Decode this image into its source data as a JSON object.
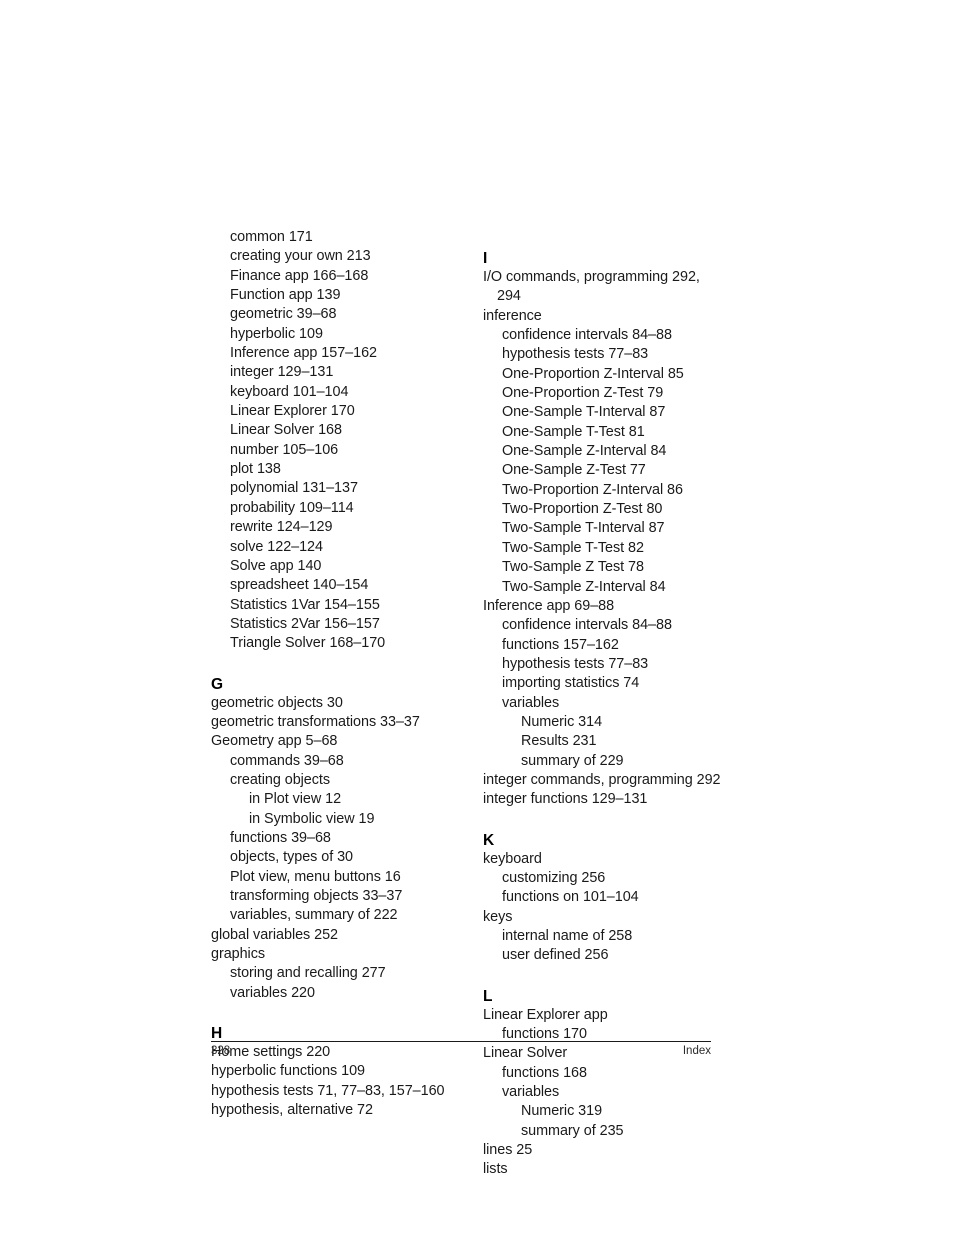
{
  "document": {
    "type": "book-index-page",
    "footer": {
      "page_number": "328",
      "section_label": "Index"
    }
  },
  "columns": {
    "left": {
      "continued_entries": [
        {
          "text": "common 171",
          "level": 1
        },
        {
          "text": "creating your own 213",
          "level": 1
        },
        {
          "text": "Finance app 166–168",
          "level": 1
        },
        {
          "text": "Function app 139",
          "level": 1
        },
        {
          "text": "geometric 39–68",
          "level": 1
        },
        {
          "text": "hyperbolic 109",
          "level": 1
        },
        {
          "text": "Inference app 157–162",
          "level": 1
        },
        {
          "text": "integer 129–131",
          "level": 1
        },
        {
          "text": "keyboard 101–104",
          "level": 1
        },
        {
          "text": "Linear Explorer 170",
          "level": 1
        },
        {
          "text": "Linear Solver 168",
          "level": 1
        },
        {
          "text": "number 105–106",
          "level": 1
        },
        {
          "text": "plot 138",
          "level": 1
        },
        {
          "text": "polynomial 131–137",
          "level": 1
        },
        {
          "text": "probability 109–114",
          "level": 1
        },
        {
          "text": "rewrite 124–129",
          "level": 1
        },
        {
          "text": "solve 122–124",
          "level": 1
        },
        {
          "text": "Solve app 140",
          "level": 1
        },
        {
          "text": "spreadsheet 140–154",
          "level": 1
        },
        {
          "text": "Statistics 1Var 154–155",
          "level": 1
        },
        {
          "text": "Statistics 2Var 156–157",
          "level": 1
        },
        {
          "text": "Triangle Solver 168–170",
          "level": 1
        }
      ],
      "sections": [
        {
          "letter": "G",
          "entries": [
            {
              "text": "geometric objects 30",
              "level": 0
            },
            {
              "text": "geometric transformations 33–37",
              "level": 0
            },
            {
              "text": "Geometry app 5–68",
              "level": 0
            },
            {
              "text": "commands 39–68",
              "level": 1
            },
            {
              "text": "creating objects",
              "level": 1
            },
            {
              "text": "in Plot view 12",
              "level": 2
            },
            {
              "text": "in Symbolic view 19",
              "level": 2
            },
            {
              "text": "functions 39–68",
              "level": 1
            },
            {
              "text": "objects, types of 30",
              "level": 1
            },
            {
              "text": "Plot view, menu buttons 16",
              "level": 1
            },
            {
              "text": "transforming objects 33–37",
              "level": 1
            },
            {
              "text": "variables, summary of 222",
              "level": 1
            },
            {
              "text": "global variables 252",
              "level": 0
            },
            {
              "text": "graphics",
              "level": 0
            },
            {
              "text": "storing and recalling 277",
              "level": 1
            },
            {
              "text": "variables 220",
              "level": 1
            }
          ]
        },
        {
          "letter": "H",
          "entries": [
            {
              "text": "Home settings 220",
              "level": 0
            },
            {
              "text": "hyperbolic functions 109",
              "level": 0
            },
            {
              "text": "hypothesis tests 71, 77–83, 157–160",
              "level": 0
            },
            {
              "text": "hypothesis, alternative 72",
              "level": 0
            }
          ]
        }
      ]
    },
    "right": {
      "continued_entries": [],
      "sections": [
        {
          "letter": "I",
          "entries": [
            {
              "text": "I/O commands, programming 292,",
              "level": 0
            },
            {
              "text": "294",
              "level": "cont"
            },
            {
              "text": "inference",
              "level": 0
            },
            {
              "text": "confidence intervals 84–88",
              "level": 1
            },
            {
              "text": "hypothesis tests 77–83",
              "level": 1
            },
            {
              "text": "One-Proportion Z-Interval 85",
              "level": 1
            },
            {
              "text": "One-Proportion Z-Test 79",
              "level": 1
            },
            {
              "text": "One-Sample T-Interval 87",
              "level": 1
            },
            {
              "text": "One-Sample T-Test 81",
              "level": 1
            },
            {
              "text": "One-Sample Z-Interval 84",
              "level": 1
            },
            {
              "text": "One-Sample Z-Test 77",
              "level": 1
            },
            {
              "text": "Two-Proportion Z-Interval 86",
              "level": 1
            },
            {
              "text": "Two-Proportion Z-Test 80",
              "level": 1
            },
            {
              "text": "Two-Sample T-Interval 87",
              "level": 1
            },
            {
              "text": "Two-Sample T-Test 82",
              "level": 1
            },
            {
              "text": "Two-Sample Z Test 78",
              "level": 1
            },
            {
              "text": "Two-Sample Z-Interval 84",
              "level": 1
            },
            {
              "text": "Inference app 69–88",
              "level": 0
            },
            {
              "text": "confidence intervals 84–88",
              "level": 1
            },
            {
              "text": "functions 157–162",
              "level": 1
            },
            {
              "text": "hypothesis tests 77–83",
              "level": 1
            },
            {
              "text": "importing statistics 74",
              "level": 1
            },
            {
              "text": "variables",
              "level": 1
            },
            {
              "text": "Numeric 314",
              "level": 2
            },
            {
              "text": "Results 231",
              "level": 2
            },
            {
              "text": "summary of 229",
              "level": 2
            },
            {
              "text": "integer commands, programming 292",
              "level": 0
            },
            {
              "text": "integer functions 129–131",
              "level": 0
            }
          ]
        },
        {
          "letter": "K",
          "entries": [
            {
              "text": "keyboard",
              "level": 0
            },
            {
              "text": "customizing 256",
              "level": 1
            },
            {
              "text": "functions on 101–104",
              "level": 1
            },
            {
              "text": "keys",
              "level": 0
            },
            {
              "text": "internal name of 258",
              "level": 1
            },
            {
              "text": "user defined 256",
              "level": 1
            }
          ]
        },
        {
          "letter": "L",
          "entries": [
            {
              "text": "Linear Explorer app",
              "level": 0
            },
            {
              "text": "functions 170",
              "level": 1
            },
            {
              "text": "Linear Solver",
              "level": 0
            },
            {
              "text": "functions 168",
              "level": 1
            },
            {
              "text": "variables",
              "level": 1
            },
            {
              "text": "Numeric 319",
              "level": 2
            },
            {
              "text": "summary of 235",
              "level": 2
            },
            {
              "text": "lines 25",
              "level": 0
            },
            {
              "text": "lists",
              "level": 0
            }
          ]
        }
      ]
    }
  }
}
